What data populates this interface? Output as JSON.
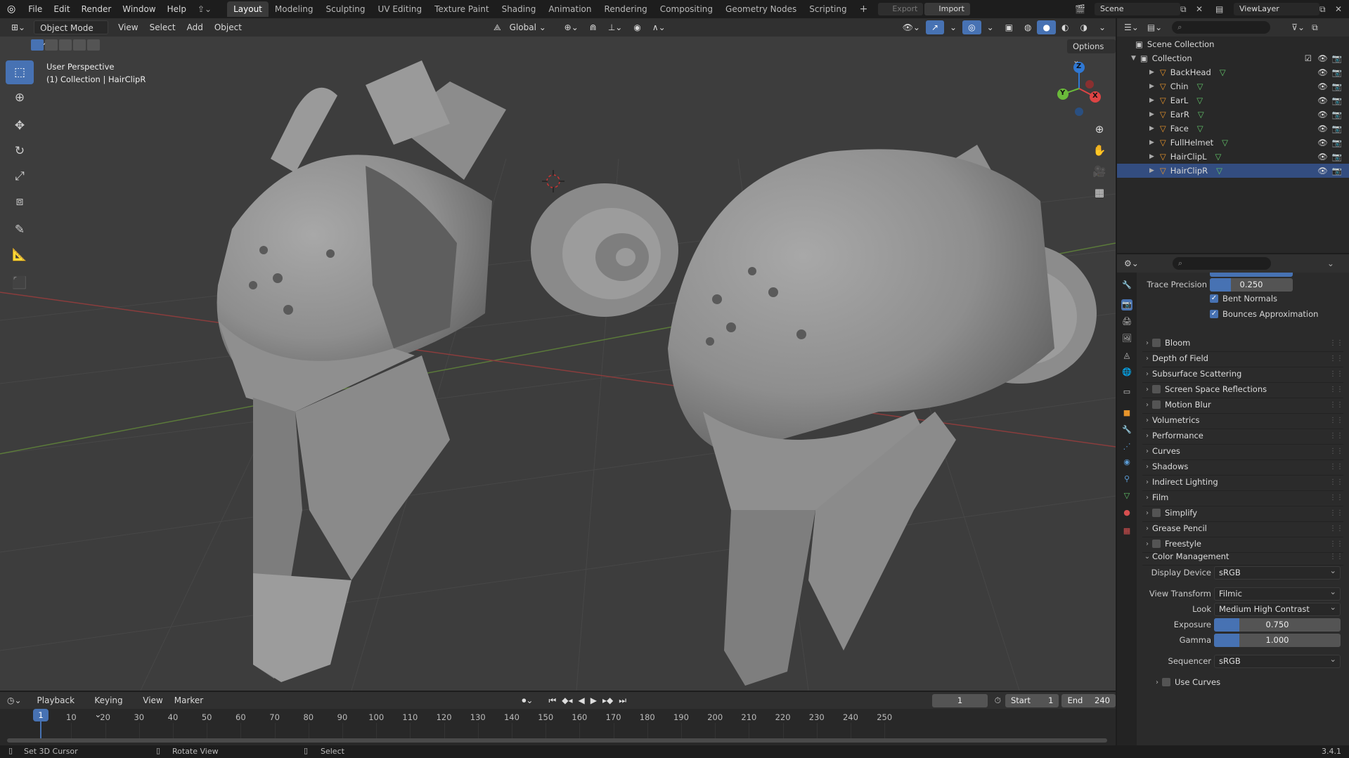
{
  "app": {
    "version": "3.4.1"
  },
  "menu": [
    "File",
    "Edit",
    "Render",
    "Window",
    "Help"
  ],
  "workspaces": [
    "Layout",
    "Modeling",
    "Sculpting",
    "UV Editing",
    "Texture Paint",
    "Shading",
    "Animation",
    "Rendering",
    "Compositing",
    "Geometry Nodes",
    "Scripting"
  ],
  "active_workspace": "Layout",
  "topbar": {
    "export_label": "Export",
    "import_label": "Import",
    "scene": "Scene",
    "view_layer": "ViewLayer"
  },
  "viewport": {
    "mode": "Object Mode",
    "menus": [
      "View",
      "Select",
      "Add",
      "Object"
    ],
    "orientation": "Global",
    "overlay_title": "User Perspective",
    "overlay_sub": "(1) Collection | HairClipR",
    "options_label": "Options",
    "axis": {
      "z": "Z",
      "y": "Y",
      "x": "X"
    }
  },
  "outliner": {
    "root": "Scene Collection",
    "collection": "Collection",
    "objects": [
      "BackHead",
      "Chin",
      "EarL",
      "EarR",
      "Face",
      "FullHelmet",
      "HairClipL",
      "HairClipR"
    ],
    "selected": "HairClipR"
  },
  "properties": {
    "trace_precision_label": "Trace Precision",
    "trace_precision": "0.250",
    "trace_precision_fraction": 0.25,
    "bent_normals": "Bent Normals",
    "bounces_approx": "Bounces Approximation",
    "panels": [
      {
        "label": "Bloom",
        "checkbox": true
      },
      {
        "label": "Depth of Field",
        "checkbox": false
      },
      {
        "label": "Subsurface Scattering",
        "checkbox": false
      },
      {
        "label": "Screen Space Reflections",
        "checkbox": true
      },
      {
        "label": "Motion Blur",
        "checkbox": true
      },
      {
        "label": "Volumetrics",
        "checkbox": false
      },
      {
        "label": "Performance",
        "checkbox": false
      },
      {
        "label": "Curves",
        "checkbox": false
      },
      {
        "label": "Shadows",
        "checkbox": false
      },
      {
        "label": "Indirect Lighting",
        "checkbox": false
      },
      {
        "label": "Film",
        "checkbox": false
      },
      {
        "label": "Simplify",
        "checkbox": true
      },
      {
        "label": "Grease Pencil",
        "checkbox": false
      },
      {
        "label": "Freestyle",
        "checkbox": true
      }
    ],
    "color_management": {
      "title": "Color Management",
      "display_device_label": "Display Device",
      "display_device": "sRGB",
      "view_transform_label": "View Transform",
      "view_transform": "Filmic",
      "look_label": "Look",
      "look": "Medium High Contrast",
      "exposure_label": "Exposure",
      "exposure": "0.750",
      "exposure_fraction": 0.2,
      "gamma_label": "Gamma",
      "gamma": "1.000",
      "gamma_fraction": 0.2,
      "sequencer_label": "Sequencer",
      "sequencer": "sRGB",
      "use_curves": "Use Curves"
    }
  },
  "timeline": {
    "menus": [
      "Playback",
      "Keying",
      "View",
      "Marker"
    ],
    "current_frame": "1",
    "start_label": "Start",
    "start": "1",
    "end_label": "End",
    "end": "240",
    "ticks": [
      "1",
      "10",
      "20",
      "30",
      "40",
      "50",
      "60",
      "70",
      "80",
      "90",
      "100",
      "110",
      "120",
      "130",
      "140",
      "150",
      "160",
      "170",
      "180",
      "190",
      "200",
      "210",
      "220",
      "230",
      "240",
      "250"
    ]
  },
  "status": {
    "left": "Set 3D Cursor",
    "middle": "Rotate View",
    "right": "Select"
  },
  "colors": {
    "accent": "#4772b3",
    "bg": "#3d3d3d",
    "panel": "#2b2b2b",
    "object_orange": "#e8952b",
    "mesh_green": "#62c46a"
  }
}
